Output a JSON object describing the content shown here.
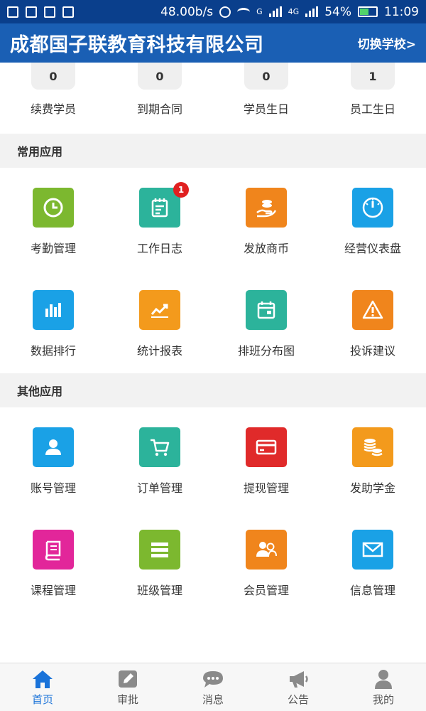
{
  "status_bar": {
    "speed": "48.00b/s",
    "network_g": "G",
    "network_4g": "4G",
    "battery": "54%",
    "time": "11:09"
  },
  "header": {
    "title": "成都国子联教育科技有限公司",
    "switch_label": "切换学校>"
  },
  "stats": [
    {
      "value": "0",
      "label": "续费学员"
    },
    {
      "value": "0",
      "label": "到期合同"
    },
    {
      "value": "0",
      "label": "学员生日"
    },
    {
      "value": "1",
      "label": "员工生日"
    }
  ],
  "common_apps": {
    "title": "常用应用",
    "items": [
      {
        "label": "考勤管理",
        "icon": "clock-icon",
        "color": "#7cb82f"
      },
      {
        "label": "工作日志",
        "icon": "notepad-icon",
        "color": "#2cb39b",
        "badge": "1"
      },
      {
        "label": "发放商币",
        "icon": "coins-hand-icon",
        "color": "#f0851c"
      },
      {
        "label": "经营仪表盘",
        "icon": "gauge-icon",
        "color": "#1aa1e6"
      },
      {
        "label": "数据排行",
        "icon": "bar-chart-icon",
        "color": "#1aa1e6"
      },
      {
        "label": "统计报表",
        "icon": "line-chart-icon",
        "color": "#f39a1c"
      },
      {
        "label": "排班分布图",
        "icon": "calendar-icon",
        "color": "#2cb39b"
      },
      {
        "label": "投诉建议",
        "icon": "warning-icon",
        "color": "#f0851c"
      }
    ]
  },
  "other_apps": {
    "title": "其他应用",
    "items": [
      {
        "label": "账号管理",
        "icon": "user-icon",
        "color": "#1aa1e6"
      },
      {
        "label": "订单管理",
        "icon": "cart-icon",
        "color": "#2cb39b"
      },
      {
        "label": "提现管理",
        "icon": "card-icon",
        "color": "#e02a2a"
      },
      {
        "label": "发助学金",
        "icon": "coin-stack-icon",
        "color": "#f39a1c"
      },
      {
        "label": "课程管理",
        "icon": "book-icon",
        "color": "#e2269a"
      },
      {
        "label": "班级管理",
        "icon": "list-icon",
        "color": "#7cb82f"
      },
      {
        "label": "会员管理",
        "icon": "members-icon",
        "color": "#f0851c"
      },
      {
        "label": "信息管理",
        "icon": "mail-icon",
        "color": "#1aa1e6"
      }
    ]
  },
  "tabs": [
    {
      "label": "首页",
      "icon": "home-icon",
      "active": true
    },
    {
      "label": "审批",
      "icon": "edit-icon",
      "active": false
    },
    {
      "label": "消息",
      "icon": "chat-icon",
      "active": false
    },
    {
      "label": "公告",
      "icon": "megaphone-icon",
      "active": false
    },
    {
      "label": "我的",
      "icon": "profile-icon",
      "active": false
    }
  ],
  "colors": {
    "header": "#1a5fb4",
    "status_bar": "#0a3f8c",
    "tab_active": "#1a73d9",
    "tab_inactive": "#8a8a8a"
  }
}
